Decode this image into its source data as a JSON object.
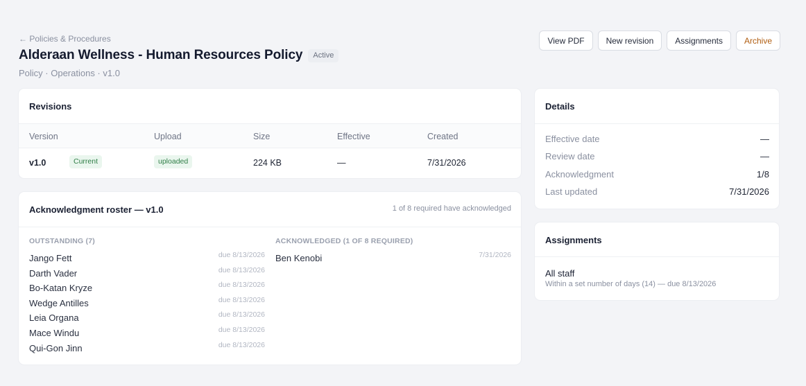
{
  "breadcrumb": "← Policies & Procedures",
  "page": {
    "title": "Alderaan Wellness - Human Resources Policy",
    "status": "Active",
    "subtitle": "Policy · Operations · v1.0"
  },
  "actions": {
    "view_pdf": "View PDF",
    "new_revision": "New revision",
    "assignments": "Assignments",
    "archive": "Archive"
  },
  "revisions": {
    "title": "Revisions",
    "columns": [
      "Version",
      "Upload",
      "Size",
      "Effective",
      "Created"
    ],
    "rows": [
      {
        "version": "v1.0",
        "current": "Current",
        "upload": "uploaded",
        "size": "224 KB",
        "effective": "—",
        "created": "7/31/2026"
      }
    ]
  },
  "roster": {
    "title": "Acknowledgment roster — v1.0",
    "summary": "1 of 8 required have acknowledged",
    "outstanding_heading": "OUTSTANDING (7)",
    "acknowledged_heading": "ACKNOWLEDGED (1 OF 8 REQUIRED)",
    "outstanding": [
      {
        "name": "Jango Fett",
        "date": "due 8/13/2026"
      },
      {
        "name": "Darth Vader",
        "date": "due 8/13/2026"
      },
      {
        "name": "Bo-Katan Kryze",
        "date": "due 8/13/2026"
      },
      {
        "name": "Wedge Antilles",
        "date": "due 8/13/2026"
      },
      {
        "name": "Leia Organa",
        "date": "due 8/13/2026"
      },
      {
        "name": "Mace Windu",
        "date": "due 8/13/2026"
      },
      {
        "name": "Qui-Gon Jinn",
        "date": "due 8/13/2026"
      }
    ],
    "acknowledged": [
      {
        "name": "Ben Kenobi",
        "date": "7/31/2026"
      }
    ]
  },
  "details": {
    "title": "Details",
    "rows": [
      {
        "label": "Effective date",
        "value": "—"
      },
      {
        "label": "Review date",
        "value": "—"
      },
      {
        "label": "Acknowledgment",
        "value": "1/8"
      },
      {
        "label": "Last updated",
        "value": "7/31/2026"
      }
    ]
  },
  "assignments": {
    "title": "Assignments",
    "items": [
      {
        "name": "All staff",
        "description": "Within a set number of days (14) — due 8/13/2026"
      }
    ]
  },
  "colors": {
    "accent_archive": "#b05d10",
    "status_green": "#2e7d45",
    "background": "#f3f4f7"
  }
}
